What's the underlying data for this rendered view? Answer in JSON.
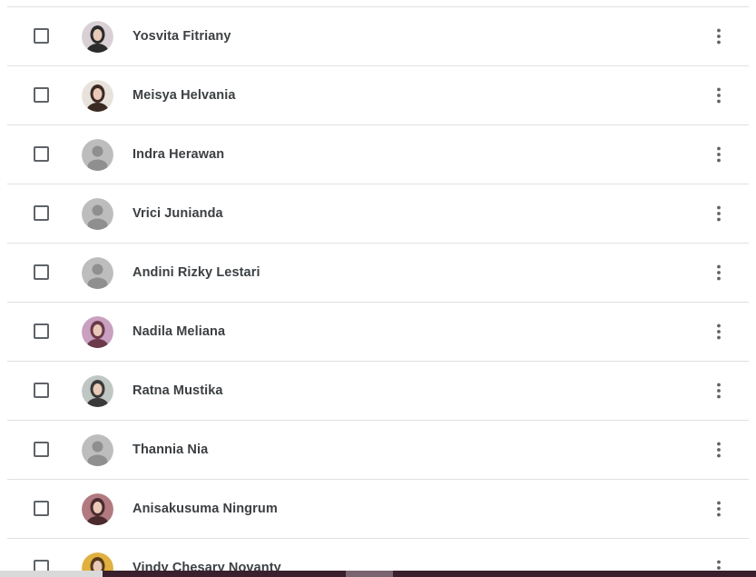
{
  "people": [
    {
      "name": "Yosvita Fitriany",
      "avatar": "photo",
      "photo_color": "#2b2b2b",
      "photo_bg": "#d8d0d4"
    },
    {
      "name": "Meisya Helvania",
      "avatar": "photo",
      "photo_color": "#3a2a22",
      "photo_bg": "#e8e2dc"
    },
    {
      "name": "Indra Herawan",
      "avatar": "default"
    },
    {
      "name": "Vrici Junianda",
      "avatar": "default"
    },
    {
      "name": "Andini Rizky Lestari",
      "avatar": "default"
    },
    {
      "name": "Nadila Meliana",
      "avatar": "photo",
      "photo_color": "#6a3a4a",
      "photo_bg": "#c9a0c0"
    },
    {
      "name": "Ratna Mustika",
      "avatar": "photo",
      "photo_color": "#3a3a3a",
      "photo_bg": "#bfc7c4"
    },
    {
      "name": "Thannia Nia",
      "avatar": "default"
    },
    {
      "name": "Anisakusuma Ningrum",
      "avatar": "photo",
      "photo_color": "#4a2a2e",
      "photo_bg": "#b07a80"
    },
    {
      "name": "Vindy Chesary Novanty",
      "avatar": "photo",
      "photo_color": "#5a3a18",
      "photo_bg": "#e0b040"
    }
  ],
  "icons": {
    "checkbox": "checkbox-unchecked-icon",
    "more": "more-vert-icon",
    "default_avatar": "person-icon"
  },
  "colors": {
    "text": "#3c4043",
    "divider": "#e0e0e0",
    "default_avatar_bg": "#bdbdbd",
    "default_avatar_fg": "#8f8f8f",
    "icon": "#5f6368"
  }
}
